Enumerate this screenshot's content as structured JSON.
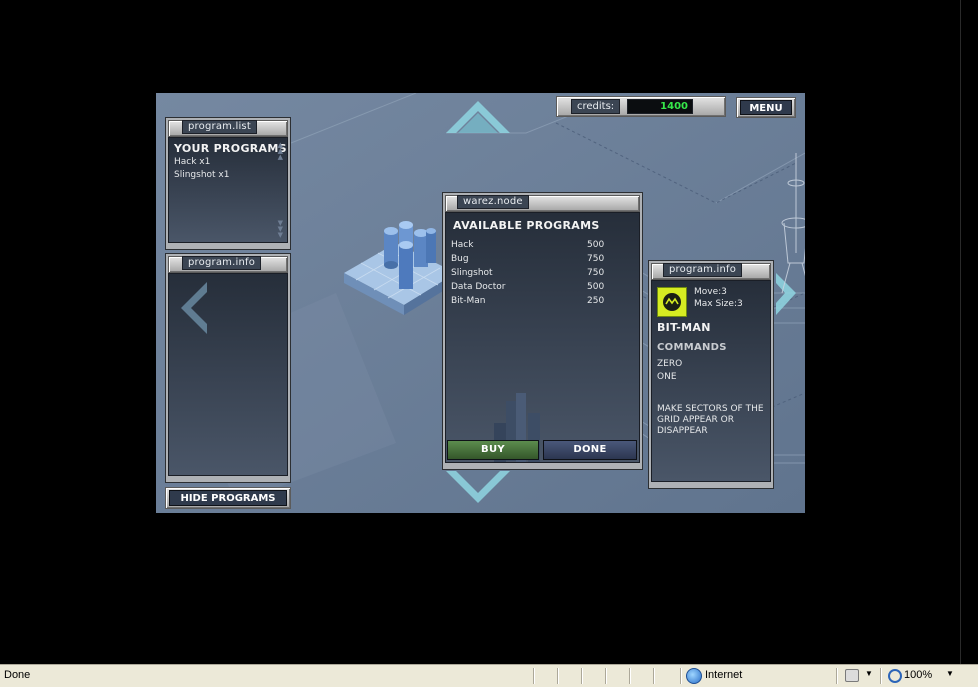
{
  "game": {
    "credits_label": "credits:",
    "credits_value": "1400",
    "menu_label": "MENU",
    "program_list": {
      "tab": "program.list",
      "heading": "YOUR PROGRAMS",
      "items": [
        "Hack x1",
        "Slingshot x1"
      ]
    },
    "program_info_left": {
      "tab": "program.info"
    },
    "hide_programs_label": "HIDE PROGRAMS",
    "warez_node": {
      "tab": "warez.node",
      "heading": "AVAILABLE PROGRAMS",
      "items": [
        {
          "name": "Hack",
          "price": "500"
        },
        {
          "name": "Bug",
          "price": "750"
        },
        {
          "name": "Slingshot",
          "price": "750"
        },
        {
          "name": "Data Doctor",
          "price": "500"
        },
        {
          "name": "Bit-Man",
          "price": "250"
        }
      ],
      "buy_label": "BUY",
      "done_label": "DONE"
    },
    "program_info_right": {
      "tab": "program.info",
      "move": "Move:3",
      "max_size": "Max Size:3",
      "name": "BIT-MAN",
      "commands_heading": "COMMANDS",
      "commands": [
        "ZERO",
        "ONE"
      ],
      "description": "MAKE SECTORS OF THE GRID APPEAR OR DISAPPEAR"
    }
  },
  "status_bar": {
    "status": "Done",
    "zone": "Internet",
    "zoom": "100%"
  },
  "colors": {
    "background": "#6c809a",
    "credits_text": "#36e84a",
    "buy_button": "#3f6b34",
    "done_button": "#34405a",
    "panel_frame": "#aeb1b5"
  },
  "icons": {
    "bitman": "bitman-icon",
    "zone": "globe-icon",
    "zoom": "zoom-icon",
    "security": "lock-icon"
  }
}
